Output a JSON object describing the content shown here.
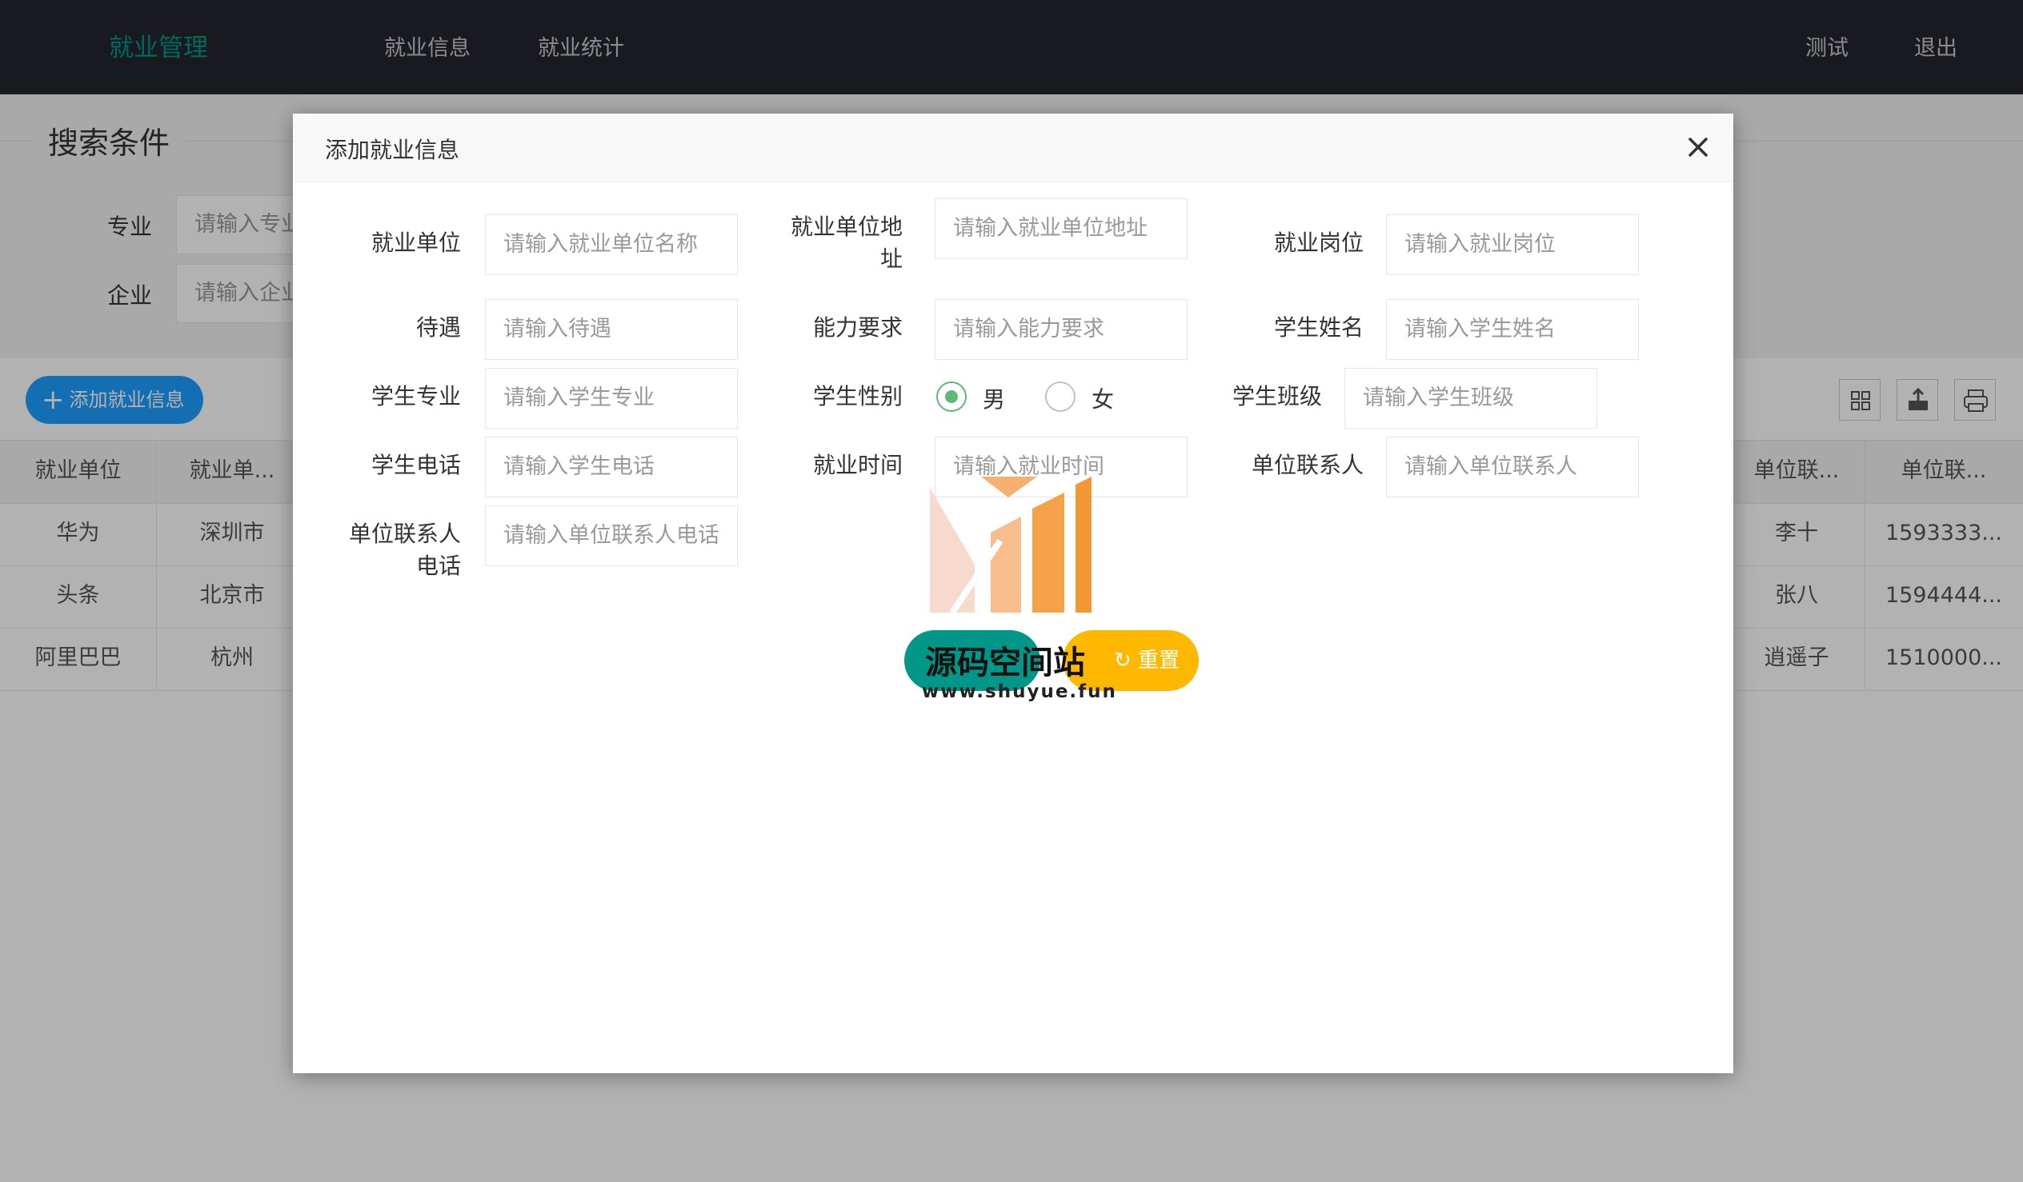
{
  "header": {
    "logo": "就业管理",
    "nav": [
      "就业信息",
      "就业统计"
    ],
    "right": [
      "测试",
      "退出"
    ]
  },
  "search": {
    "legend": "搜索条件",
    "fields": [
      {
        "label": "专业",
        "placeholder": "请输入专业"
      },
      {
        "label": "企业",
        "placeholder": "请输入企业"
      }
    ]
  },
  "toolbar": {
    "add_label": "添加就业信息",
    "icons": [
      "columns-icon",
      "export-icon",
      "print-icon"
    ]
  },
  "table": {
    "headers_left": [
      "就业单位",
      "就业单..."
    ],
    "headers_right": [
      "单位联...",
      "单位联..."
    ],
    "rows": [
      {
        "unit": "华为",
        "addr": "深圳市",
        "contact": "李十",
        "phone": "1593333..."
      },
      {
        "unit": "头条",
        "addr": "北京市",
        "contact": "张八",
        "phone": "1594444..."
      },
      {
        "unit": "阿里巴巴",
        "addr": "杭州",
        "contact": "逍遥子",
        "phone": "1510000..."
      }
    ]
  },
  "modal": {
    "title": "添加就业信息",
    "fields": {
      "unit": {
        "label": "就业单位",
        "placeholder": "请输入就业单位名称"
      },
      "address": {
        "label_line1": "就业单位地",
        "label_line2": "址",
        "placeholder": "请输入就业单位地址"
      },
      "post": {
        "label": "就业岗位",
        "placeholder": "请输入就业岗位"
      },
      "salary": {
        "label": "待遇",
        "placeholder": "请输入待遇"
      },
      "ability": {
        "label": "能力要求",
        "placeholder": "请输入能力要求"
      },
      "student_name": {
        "label": "学生姓名",
        "placeholder": "请输入学生姓名"
      },
      "major": {
        "label": "学生专业",
        "placeholder": "请输入学生专业"
      },
      "gender": {
        "label": "学生性别",
        "options": [
          "男",
          "女"
        ],
        "selected": "男"
      },
      "class": {
        "label": "学生班级",
        "placeholder": "请输入学生班级"
      },
      "phone": {
        "label": "学生电话",
        "placeholder": "请输入学生电话"
      },
      "time": {
        "label": "就业时间",
        "placeholder": "请输入就业时间"
      },
      "contact": {
        "label": "单位联系人",
        "placeholder": "请输入单位联系人"
      },
      "contact_phone": {
        "label_line1": "单位联系人",
        "label_line2": "电话",
        "placeholder": "请输入单位联系人电话"
      }
    },
    "submit_label": "",
    "reset_label": "重置"
  },
  "watermark": {
    "title": "源码空间站",
    "url": "www.shuyue.fun"
  }
}
